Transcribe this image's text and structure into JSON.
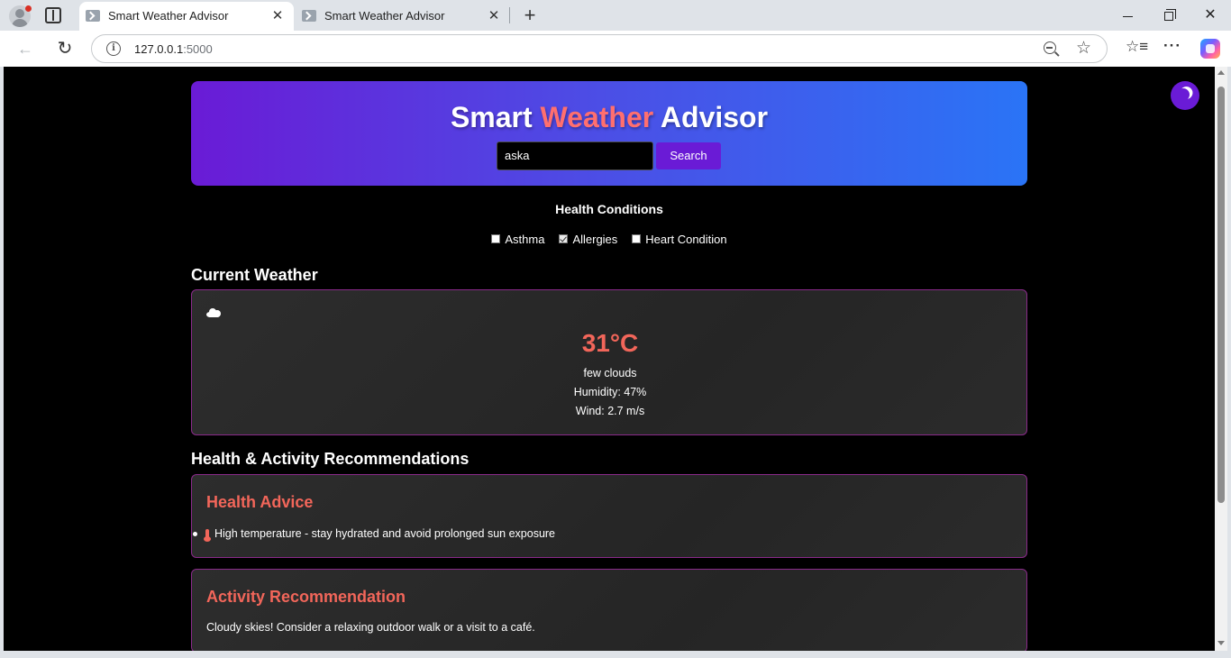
{
  "browser": {
    "tabs": [
      {
        "title": "Smart Weather Advisor",
        "active": true
      },
      {
        "title": "Smart Weather Advisor",
        "active": false
      }
    ],
    "url_host": "127.0.0.1",
    "url_port": ":5000",
    "close_glyph": "✕",
    "new_tab_glyph": "+"
  },
  "app": {
    "title_part1": "Smart ",
    "title_accent": "Weather",
    "title_part2": " Advisor",
    "search_value": "aska",
    "search_button": "Search",
    "accent_color": "#ff6f6f",
    "brand_color": "#6a1bd6"
  },
  "health_conditions": {
    "title": "Health Conditions",
    "options": [
      {
        "label": "Asthma",
        "checked": false
      },
      {
        "label": "Allergies",
        "checked": true
      },
      {
        "label": "Heart Condition",
        "checked": false
      }
    ]
  },
  "current_weather": {
    "heading": "Current Weather",
    "icon": "cloud-icon",
    "temperature": "31°C",
    "description": "few clouds",
    "humidity": "Humidity: 47%",
    "wind": "Wind: 2.7 m/s"
  },
  "recommendations": {
    "heading": "Health & Activity Recommendations",
    "health_title": "Health Advice",
    "health_items": [
      "High temperature - stay hydrated and avoid prolonged sun exposure"
    ],
    "activity_title": "Activity Recommendation",
    "activity_text": "Cloudy skies! Consider a relaxing outdoor walk or a visit to a café."
  }
}
